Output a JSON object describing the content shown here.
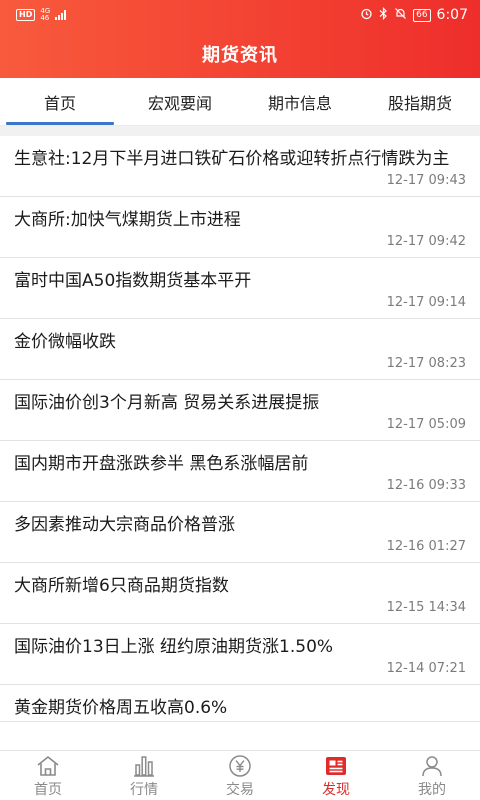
{
  "status_bar": {
    "hd": "HD",
    "network_top": "4G",
    "network_bottom": "46",
    "battery": "66",
    "time": "6:07"
  },
  "header": {
    "title": "期货资讯"
  },
  "tabs": [
    {
      "label": "首页",
      "active": true
    },
    {
      "label": "宏观要闻",
      "active": false
    },
    {
      "label": "期市信息",
      "active": false
    },
    {
      "label": "股指期货",
      "active": false
    }
  ],
  "news": [
    {
      "title": "生意社:12月下半月进口铁矿石价格或迎转折点行情跌为主",
      "time": "12-17 09:43"
    },
    {
      "title": "大商所:加快气煤期货上市进程",
      "time": "12-17 09:42"
    },
    {
      "title": "富时中国A50指数期货基本平开",
      "time": "12-17 09:14"
    },
    {
      "title": "金价微幅收跌",
      "time": "12-17 08:23"
    },
    {
      "title": "国际油价创3个月新高 贸易关系进展提振",
      "time": "12-17 05:09"
    },
    {
      "title": "国内期市开盘涨跌参半 黑色系涨幅居前",
      "time": "12-16 09:33"
    },
    {
      "title": "多因素推动大宗商品价格普涨",
      "time": "12-16 01:27"
    },
    {
      "title": "大商所新增6只商品期货指数",
      "time": "12-15 14:34"
    },
    {
      "title": "国际油价13日上涨 纽约原油期货涨1.50%",
      "time": "12-14 07:21"
    },
    {
      "title": "黄金期货价格周五收高0.6%",
      "time": ""
    }
  ],
  "bottom_nav": [
    {
      "label": "首页",
      "icon": "home-icon",
      "active": false
    },
    {
      "label": "行情",
      "icon": "chart-icon",
      "active": false
    },
    {
      "label": "交易",
      "icon": "yuan-icon",
      "active": false
    },
    {
      "label": "发现",
      "icon": "news-icon",
      "active": true
    },
    {
      "label": "我的",
      "icon": "user-icon",
      "active": false
    }
  ],
  "colors": {
    "accent": "#e02b2b",
    "tab_indicator": "#3a77c6",
    "header_start": "#f85a3c",
    "header_end": "#ee2e2b"
  }
}
